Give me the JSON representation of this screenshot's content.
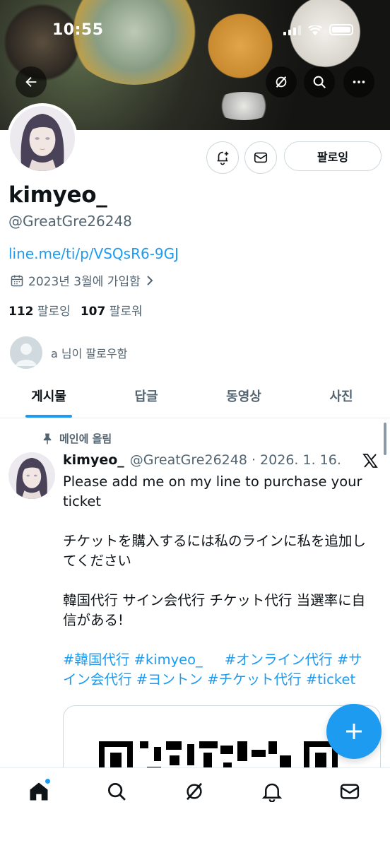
{
  "status": {
    "time": "10:55"
  },
  "profile": {
    "name": "kimyeo_",
    "handle": "@GreatGre26248",
    "link": "line.me/ti/p/VSQsR6-9GJ",
    "joined": "2023년 3월에 가입함",
    "following_count": "112",
    "following_label": "팔로잉",
    "followers_count": "107",
    "followers_label": "팔로워",
    "followed_by": "a 님이 팔로우함",
    "follow_button": "팔로잉"
  },
  "tabs": [
    {
      "label": "게시물",
      "active": true
    },
    {
      "label": "답글",
      "active": false
    },
    {
      "label": "동영상",
      "active": false
    },
    {
      "label": "사진",
      "active": false
    }
  ],
  "post": {
    "pinned_label": "메인에 올림",
    "author": "kimyeo_",
    "meta": "@GreatGre26248 · 2026. 1. 16.",
    "paragraphs": [
      "Please add me on my line to purchase your ticket",
      "チケットを購入するには私のラインに私を追加してください",
      "韓国代行 サイン会代行 チケット代行 当選率に自信がある!"
    ],
    "hashtags": "#韓国代行 #kimyeo_     #オンライン代行 #サイン会代行 #ヨントン #チケット代行 #ticket"
  },
  "icons": {
    "back": "back-arrow-icon",
    "grok": "grok-icon",
    "search": "search-icon",
    "more": "more-icon",
    "notify": "notification-add-icon",
    "message": "message-icon",
    "calendar": "calendar-icon",
    "pin": "pin-icon",
    "x": "x-logo-icon",
    "compose": "plus-icon",
    "home": "home-icon",
    "bell": "bell-icon",
    "mail": "mail-icon"
  },
  "colors": {
    "accent": "#1d9bf0",
    "text": "#0f1419",
    "secondary": "#536471"
  }
}
